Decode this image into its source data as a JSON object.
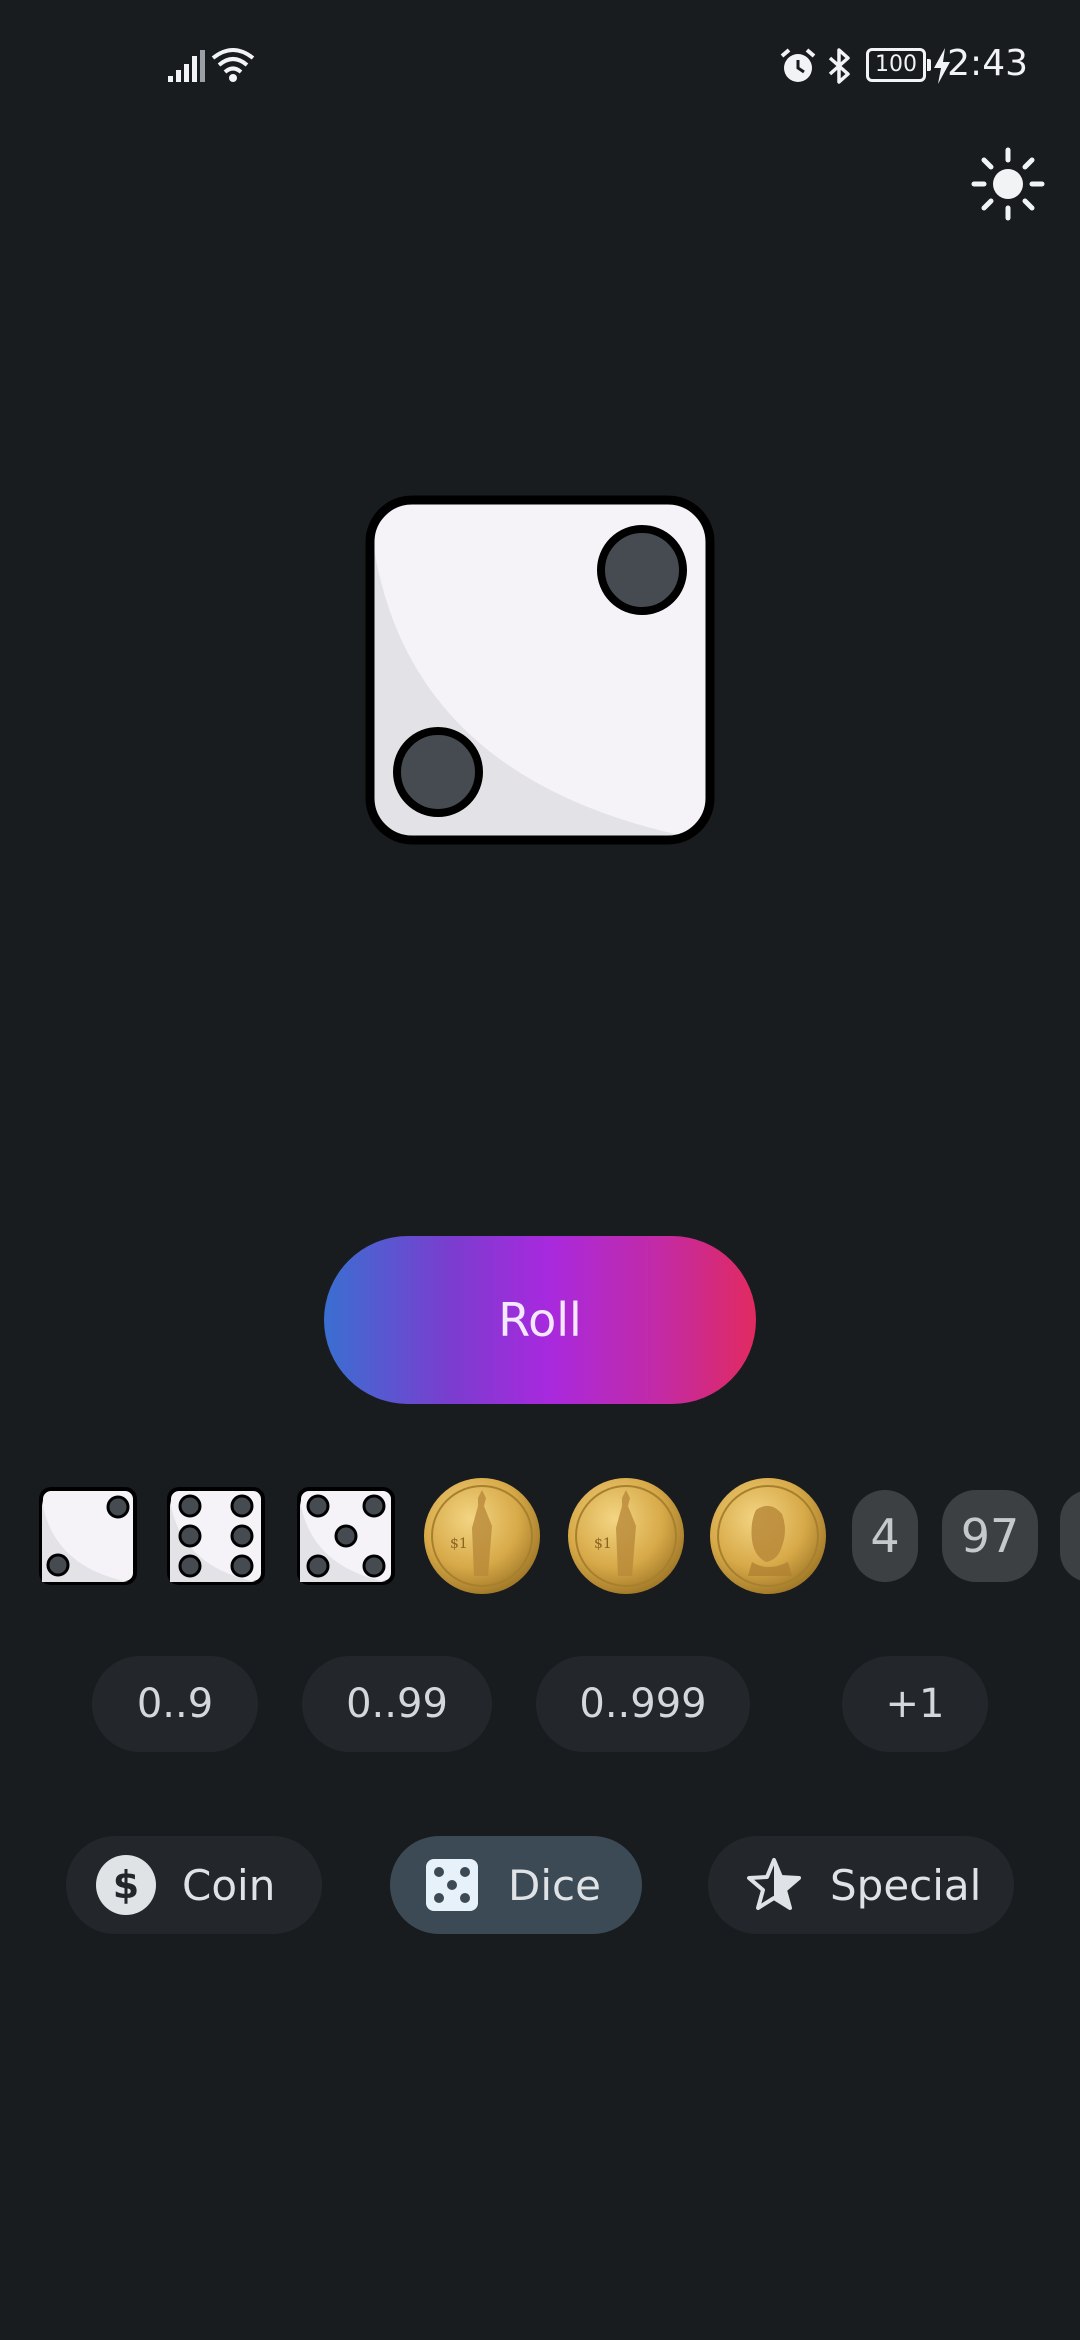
{
  "status_bar": {
    "time": "2:43",
    "battery": "100",
    "icons": [
      "signal-icon",
      "wifi-icon",
      "alarm-icon",
      "bluetooth-icon",
      "battery-icon",
      "charging-icon"
    ]
  },
  "theme_toggle": {
    "icon": "sun-icon"
  },
  "current_roll": {
    "type": "die",
    "value": 2
  },
  "roll_button": {
    "label": "Roll",
    "gradient": [
      "#3a6fd0",
      "#a829de",
      "#e12a60"
    ]
  },
  "history": {
    "items": [
      {
        "type": "die",
        "value": 2
      },
      {
        "type": "die",
        "value": 6
      },
      {
        "type": "die",
        "value": 5
      },
      {
        "type": "coin",
        "side": "tails",
        "label": "$1"
      },
      {
        "type": "coin",
        "side": "tails",
        "label": "$1"
      },
      {
        "type": "coin",
        "side": "heads"
      },
      {
        "type": "number",
        "value": "4"
      },
      {
        "type": "number",
        "value": "97"
      }
    ]
  },
  "ranges": {
    "chips": [
      {
        "label": "0..9"
      },
      {
        "label": "0..99"
      },
      {
        "label": "0..999"
      },
      {
        "label": "+1"
      }
    ]
  },
  "modes": {
    "tabs": [
      {
        "label": "Coin",
        "icon": "dollar-icon",
        "active": false
      },
      {
        "label": "Dice",
        "icon": "dice-icon",
        "active": true
      },
      {
        "label": "Special",
        "icon": "star-icon",
        "active": false
      }
    ]
  },
  "colors": {
    "background": "#191c1f",
    "chip_bg": "#23272b",
    "active_tab_bg": "#3c4a55",
    "die_face": "#f5f3f8",
    "pip": "#464b51"
  }
}
